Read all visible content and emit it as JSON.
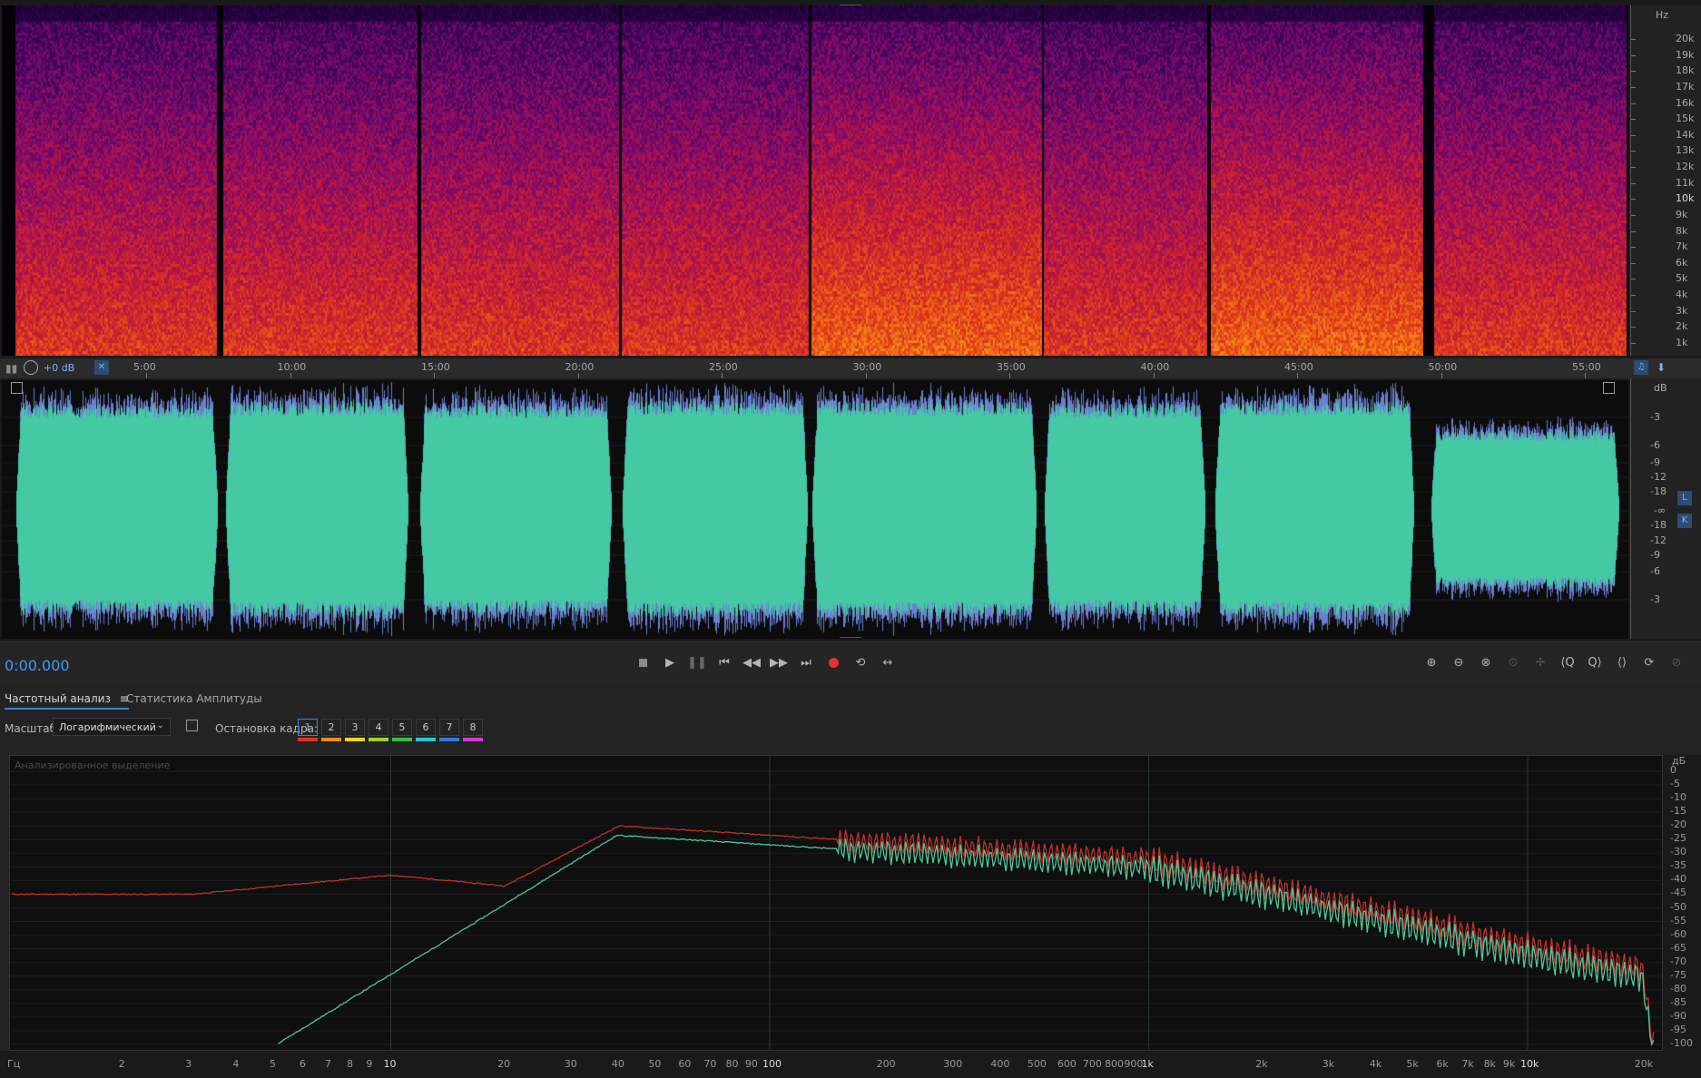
{
  "spectral": {
    "hz_label": "Hz",
    "freq_ticks": [
      "20k",
      "19k",
      "18k",
      "17k",
      "16k",
      "15k",
      "14k",
      "13k",
      "12k",
      "11k",
      "10k",
      "9k",
      "8k",
      "7k",
      "6k",
      "5k",
      "4k",
      "3k",
      "2k",
      "1k"
    ]
  },
  "ruler": {
    "gain_label": "+0 dB",
    "time_ticks": [
      "5:00",
      "10:00",
      "15:00",
      "20:00",
      "25:00",
      "30:00",
      "35:00",
      "40:00",
      "45:00",
      "50:00",
      "55:00"
    ]
  },
  "waveform": {
    "db_label": "dB",
    "db_ticks": [
      "-3",
      "-6",
      "-9",
      "-12",
      "-18",
      "-∞",
      "-18",
      "-12",
      "-9",
      "-6",
      "-3"
    ],
    "channel_left": "L",
    "channel_right": "K"
  },
  "transport": {
    "time": "0:00.000"
  },
  "panel": {
    "tab_frequency": "Частотный анализ",
    "tab_amplitude": "Статистика Амплитуды",
    "scale_label": "Масштаб:",
    "scale_value": "Логарифмический",
    "freeze_label": "Остановка кадра:",
    "frames": [
      "1",
      "2",
      "3",
      "4",
      "5",
      "6",
      "7",
      "8"
    ],
    "frame_colors": [
      "#e0312b",
      "#f08a24",
      "#e8d81f",
      "#9bd42a",
      "#36c23c",
      "#27c6d6",
      "#2f7de0",
      "#d23ad6"
    ],
    "analyzed_selection": "Анализированное выделение",
    "hz_axis_label": "Гц",
    "db_axis_label": "дБ",
    "freq_axis_ticks": [
      "2",
      "3",
      "4",
      "5",
      "6",
      "7",
      "8",
      "9",
      "10",
      "20",
      "30",
      "40",
      "50",
      "60",
      "70",
      "80",
      "90",
      "100",
      "200",
      "300",
      "400",
      "500",
      "600",
      "700",
      "800",
      "900",
      "1k",
      "2k",
      "3k",
      "4k",
      "5k",
      "6k",
      "7k",
      "8k",
      "9k",
      "10k",
      "20k"
    ],
    "db_axis_ticks": [
      "0",
      "-5",
      "-10",
      "-15",
      "-20",
      "-25",
      "-30",
      "-35",
      "-40",
      "-45",
      "-50",
      "-55",
      "-60",
      "-65",
      "-70",
      "-75",
      "-80",
      "-85",
      "-90",
      "-95",
      "-100"
    ],
    "series_colors": {
      "left": "#c2302c",
      "right": "#4fc79a"
    }
  }
}
